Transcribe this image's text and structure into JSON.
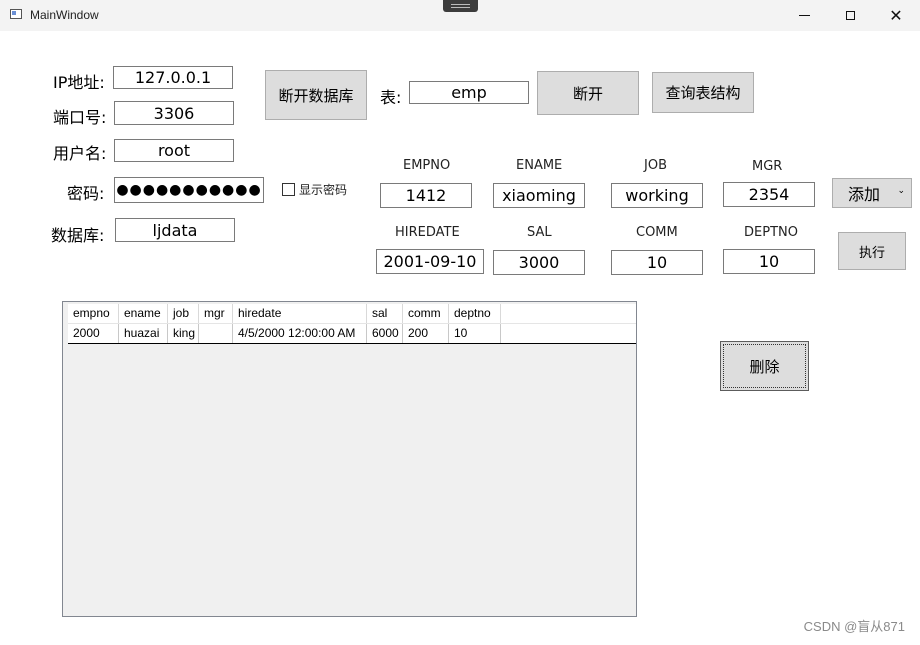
{
  "window": {
    "title": "MainWindow",
    "minimize_glyph": "",
    "close_glyph": "✕"
  },
  "connection": {
    "ip_label": "IP地址:",
    "ip_value": "127.0.0.1",
    "port_label": "端口号:",
    "port_value": "3306",
    "user_label": "用户名:",
    "user_value": "root",
    "password_label": "密码:",
    "password_value": "●●●●●●●●●●●",
    "show_password_label": "显示密码",
    "show_password_checked": false,
    "database_label": "数据库:",
    "database_value": "ljdata",
    "disconnect_db_button": "断开数据库"
  },
  "table_select": {
    "label": "表:",
    "value": "emp",
    "disconnect_button": "断开",
    "query_structure_button": "查询表结构"
  },
  "fields": {
    "empno_label": "EMPNO",
    "empno_value": "1412",
    "ename_label": "ENAME",
    "ename_value": "xiaoming",
    "job_label": "JOB",
    "job_value": "working",
    "mgr_label": "MGR",
    "mgr_value": "2354",
    "hiredate_label": "HIREDATE",
    "hiredate_value": "2001-09-10",
    "sal_label": "SAL",
    "sal_value": "3000",
    "comm_label": "COMM",
    "comm_value": "10",
    "deptno_label": "DEPTNO",
    "deptno_value": "10"
  },
  "actions": {
    "operation_select": "添加",
    "execute_button": "执行",
    "delete_button": "删除"
  },
  "grid": {
    "columns": [
      "empno",
      "ename",
      "job",
      "mgr",
      "hiredate",
      "sal",
      "comm",
      "deptno"
    ],
    "rows": [
      [
        "2000",
        "huazai",
        "king",
        "",
        "4/5/2000 12:00:00 AM",
        "6000",
        "200",
        "10"
      ]
    ]
  },
  "watermark": "CSDN @盲从871"
}
